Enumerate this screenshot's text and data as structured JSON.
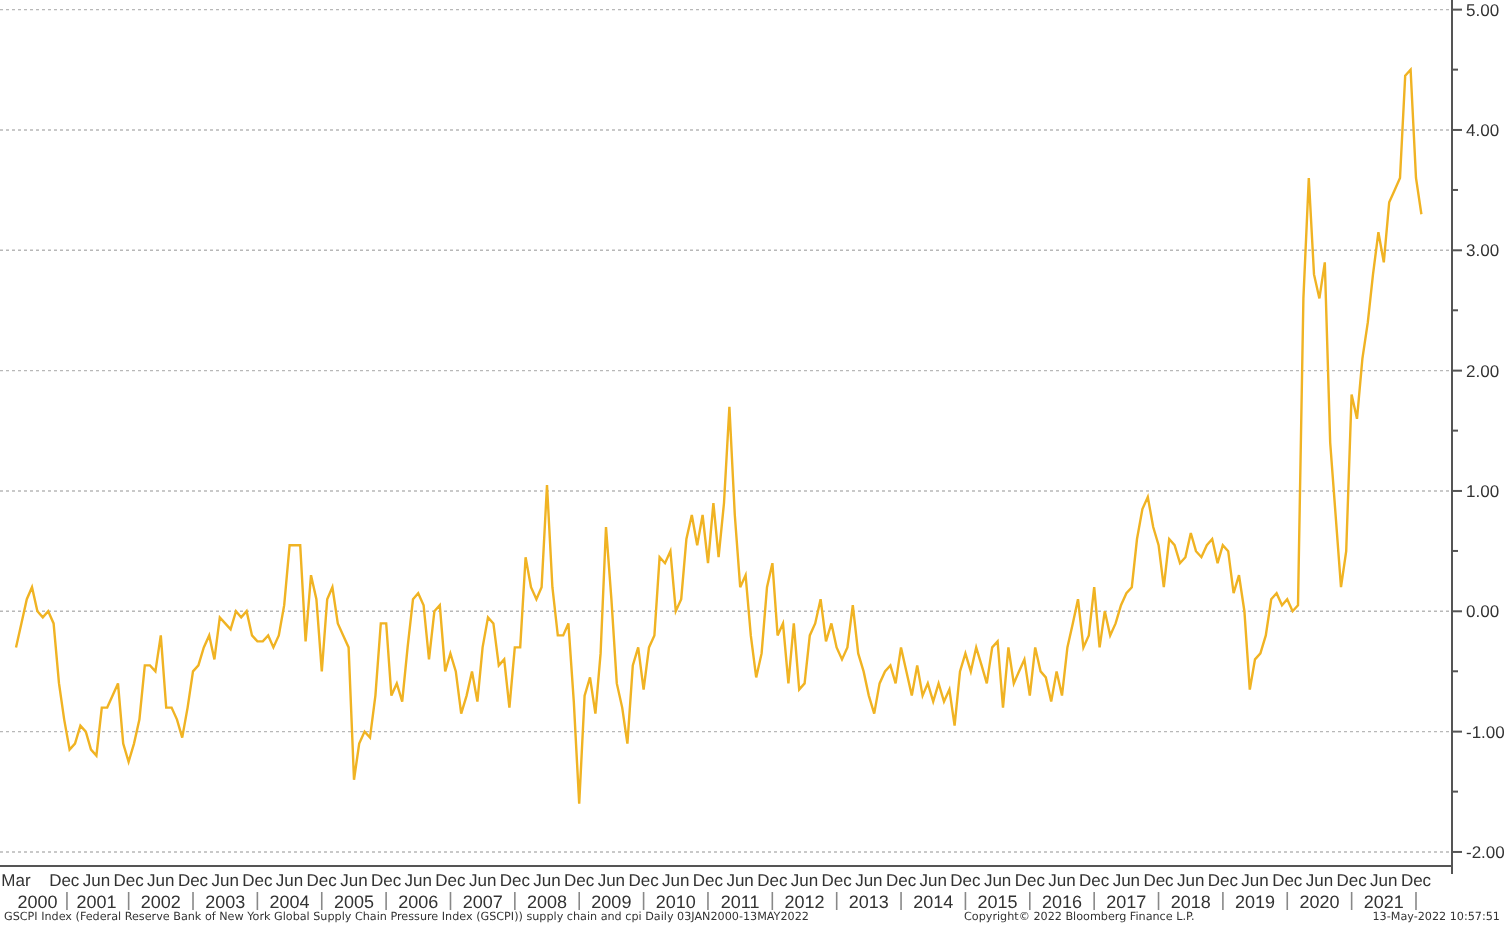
{
  "chart": {
    "chart_data": {
      "type": "line",
      "grid": true,
      "ylim": [
        -2.15,
        5.08
      ],
      "yticks": [
        {
          "value": 5,
          "label": "5.00"
        },
        {
          "value": 4,
          "label": "4.00"
        },
        {
          "value": 3,
          "label": "3.00"
        },
        {
          "value": 2,
          "label": "2.00"
        },
        {
          "value": 1,
          "label": "1.00"
        },
        {
          "value": 0,
          "label": "0.00"
        },
        {
          "value": -1,
          "label": "-1.00"
        },
        {
          "value": -2,
          "label": "-2.00"
        }
      ],
      "series": [
        {
          "color": "#f0b323",
          "values": [
            -0.3,
            -0.1,
            0.1,
            0.2,
            0,
            -0.05,
            0,
            -0.1,
            -0.6,
            -0.9,
            -1.15,
            -1.1,
            -0.95,
            -1.0,
            -1.15,
            -1.2,
            -0.8,
            -0.8,
            -0.7,
            -0.6,
            -1.1,
            -1.25,
            -1.1,
            -0.9,
            -0.45,
            -0.45,
            -0.5,
            -0.2,
            -0.8,
            -0.8,
            -0.9,
            -1.05,
            -0.8,
            -0.5,
            -0.45,
            -0.3,
            -0.2,
            -0.4,
            -0.05,
            -0.1,
            -0.15,
            0,
            -0.05,
            0,
            -0.2,
            -0.25,
            -0.25,
            -0.2,
            -0.3,
            -0.2,
            0.05,
            0.55,
            0.55,
            0.55,
            -0.25,
            0.3,
            0.1,
            -0.5,
            0.1,
            0.2,
            -0.1,
            -0.2,
            -0.3,
            -1.4,
            -1.1,
            -1.0,
            -1.05,
            -0.7,
            -0.1,
            -0.1,
            -0.7,
            -0.6,
            -0.75,
            -0.3,
            0.1,
            0.15,
            0.05,
            -0.4,
            0,
            0.05,
            -0.5,
            -0.35,
            -0.5,
            -0.85,
            -0.7,
            -0.5,
            -0.75,
            -0.3,
            -0.05,
            -0.1,
            -0.45,
            -0.4,
            -0.8,
            -0.3,
            -0.3,
            0.45,
            0.2,
            0.1,
            0.2,
            1.05,
            0.2,
            -0.2,
            -0.2,
            -0.1,
            -0.75,
            -1.6,
            -0.7,
            -0.55,
            -0.85,
            -0.35,
            0.7,
            0.1,
            -0.6,
            -0.8,
            -1.1,
            -0.45,
            -0.3,
            -0.65,
            -0.3,
            -0.2,
            0.45,
            0.4,
            0.5,
            0,
            0.1,
            0.6,
            0.8,
            0.55,
            0.8,
            0.4,
            0.9,
            0.45,
            0.9,
            1.7,
            0.8,
            0.2,
            0.3,
            -0.2,
            -0.55,
            -0.35,
            0.2,
            0.4,
            -0.2,
            -0.1,
            -0.6,
            -0.1,
            -0.65,
            -0.6,
            -0.2,
            -0.1,
            0.1,
            -0.25,
            -0.1,
            -0.3,
            -0.4,
            -0.3,
            0.05,
            -0.35,
            -0.5,
            -0.7,
            -0.85,
            -0.6,
            -0.5,
            -0.45,
            -0.6,
            -0.3,
            -0.5,
            -0.7,
            -0.45,
            -0.7,
            -0.6,
            -0.75,
            -0.6,
            -0.75,
            -0.65,
            -0.95,
            -0.5,
            -0.35,
            -0.5,
            -0.3,
            -0.45,
            -0.6,
            -0.3,
            -0.25,
            -0.8,
            -0.3,
            -0.6,
            -0.5,
            -0.4,
            -0.7,
            -0.3,
            -0.5,
            -0.55,
            -0.75,
            -0.5,
            -0.7,
            -0.3,
            -0.1,
            0.1,
            -0.3,
            -0.2,
            0.2,
            -0.3,
            0,
            -0.2,
            -0.1,
            0.05,
            0.15,
            0.2,
            0.6,
            0.85,
            0.95,
            0.7,
            0.55,
            0.2,
            0.6,
            0.55,
            0.4,
            0.45,
            0.65,
            0.5,
            0.45,
            0.55,
            0.6,
            0.4,
            0.55,
            0.5,
            0.15,
            0.3,
            0,
            -0.65,
            -0.4,
            -0.35,
            -0.2,
            0.1,
            0.15,
            0.05,
            0.1,
            0,
            0.05,
            2.6,
            3.6,
            2.8,
            2.6,
            2.9,
            1.4,
            0.8,
            0.2,
            0.5,
            1.8,
            1.6,
            2.1,
            2.4,
            2.8,
            3.15,
            2.9,
            3.4,
            3.5,
            3.6,
            4.45,
            4.5,
            3.6,
            3.3
          ]
        }
      ]
    },
    "month_labels": [
      "Mar",
      "Dec",
      "Jun",
      "Dec",
      "Jun",
      "Dec",
      "Jun",
      "Dec",
      "Jun",
      "Dec",
      "Jun",
      "Dec",
      "Jun",
      "Dec",
      "Jun",
      "Dec",
      "Jun",
      "Dec",
      "Jun",
      "Dec",
      "Jun",
      "Dec",
      "Jun",
      "Dec",
      "Jun",
      "Dec",
      "Jun",
      "Dec",
      "Jun",
      "Dec",
      "Jun",
      "Dec",
      "Jun",
      "Dec",
      "Jun",
      "Dec",
      "Jun",
      "Dec",
      "Jun",
      "Dec",
      "Jun",
      "Dec",
      "Jun",
      "Dec"
    ],
    "year_labels": [
      "2000",
      "2001",
      "2002",
      "2003",
      "2004",
      "2005",
      "2006",
      "2007",
      "2008",
      "2009",
      "2010",
      "2011",
      "2012",
      "2013",
      "2014",
      "2015",
      "2016",
      "2017",
      "2018",
      "2019",
      "2020",
      "2021"
    ]
  },
  "footer": {
    "description": "GSCPI Index (Federal Reserve Bank of New York Global Supply Chain Pressure Index (GSCPI)) supply chain and cpi  Daily 03JAN2000-13MAY2022",
    "copyright": "Copyright© 2022 Bloomberg Finance L.P.",
    "timestamp": "13-May-2022 10:57:51"
  }
}
